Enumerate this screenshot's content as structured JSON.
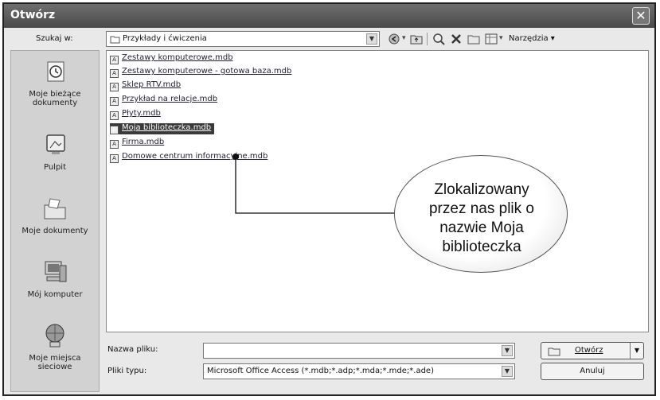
{
  "window": {
    "title": "Otwórz",
    "close_glyph": "✕"
  },
  "lookin": {
    "label": "Szukaj w:",
    "value": "Przykłady i ćwiczenia"
  },
  "toolbar": {
    "tools_label": "Narzędzia ▾"
  },
  "places": [
    {
      "label_lines": [
        "Moje bieżące",
        "dokumenty"
      ],
      "icon": "recent-documents-icon"
    },
    {
      "label_lines": [
        "Pulpit"
      ],
      "icon": "desktop-icon"
    },
    {
      "label_lines": [
        "Moje dokumenty"
      ],
      "icon": "my-documents-icon"
    },
    {
      "label_lines": [
        "Mój komputer"
      ],
      "icon": "my-computer-icon"
    },
    {
      "label_lines": [
        "Moje miejsca",
        "sieciowe"
      ],
      "icon": "network-places-icon"
    }
  ],
  "files": [
    {
      "name": "Zestawy komputerowe.mdb",
      "selected": false
    },
    {
      "name": "Zestawy komputerowe - gotowa baza.mdb",
      "selected": false
    },
    {
      "name": "Sklep RTV.mdb",
      "selected": false
    },
    {
      "name": "Przykład na relacje.mdb",
      "selected": false
    },
    {
      "name": "Płyty.mdb",
      "selected": false
    },
    {
      "name": "Moja biblioteczka.mdb",
      "selected": true
    },
    {
      "name": "Firma.mdb",
      "selected": false
    },
    {
      "name": "Domowe centrum informacyjne.mdb",
      "selected": false
    }
  ],
  "filename": {
    "label": "Nazwa pliku:",
    "value": ""
  },
  "filetype": {
    "label": "Pliki typu:",
    "value": "Microsoft Office Access (*.mdb;*.adp;*.mda;*.mde;*.ade)"
  },
  "buttons": {
    "open": "Otwórz",
    "cancel": "Anuluj"
  },
  "callout": {
    "lines": [
      "Zlokalizowany",
      "przez nas plik o",
      "nazwie Moja",
      "biblioteczka"
    ]
  }
}
